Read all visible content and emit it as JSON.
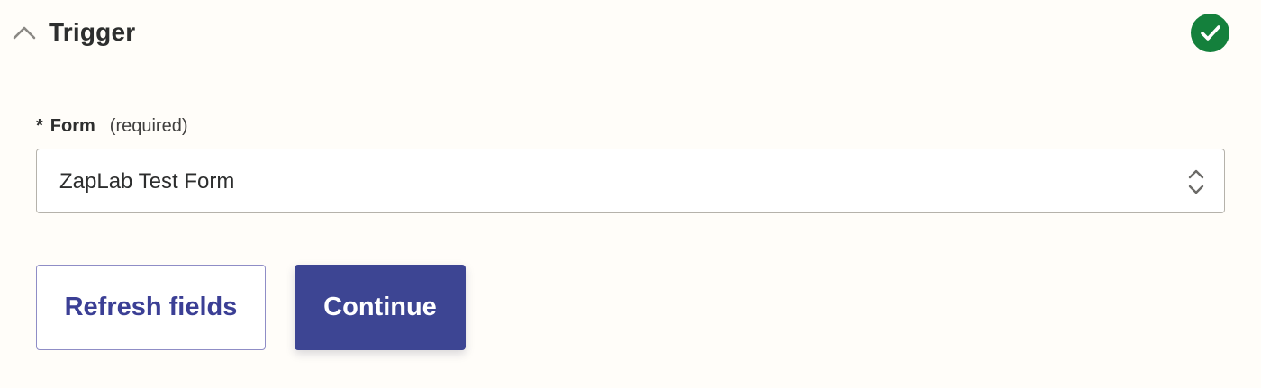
{
  "section": {
    "title": "Trigger",
    "collapse_icon": "chevron-up-icon",
    "status_icon": "check-circle-icon",
    "status_color": "#14803c"
  },
  "form_field": {
    "asterisk": "*",
    "label": "Form",
    "required_text": "(required)",
    "selected_value": "ZapLab Test Form",
    "select_icon": "chevron-up-down-icon"
  },
  "buttons": {
    "refresh_label": "Refresh fields",
    "continue_label": "Continue",
    "primary_color": "#3d4593"
  }
}
